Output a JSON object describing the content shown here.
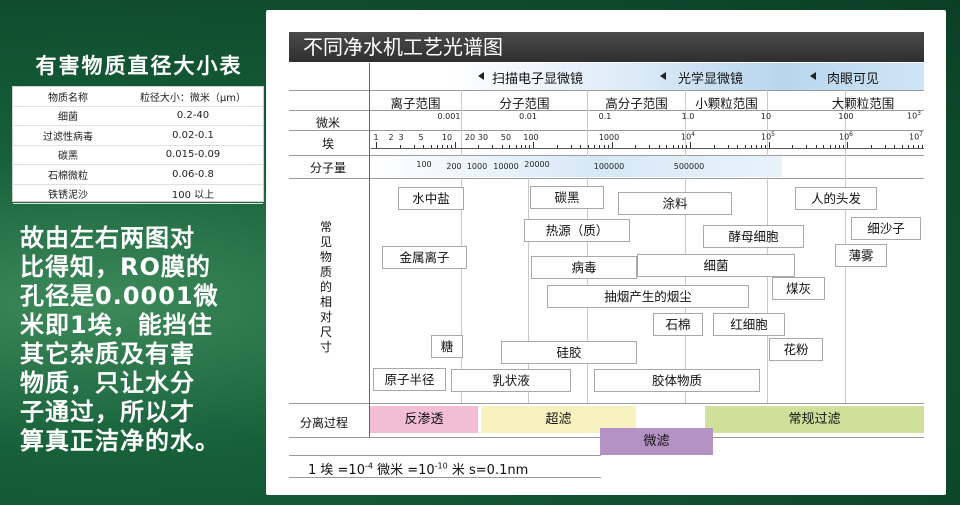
{
  "left": {
    "title": "有害物质直径大小表",
    "table_header": [
      "物质名称",
      "粒径大小：微米（μm）"
    ],
    "table_rows": [
      [
        "细菌",
        "0.2-40"
      ],
      [
        "过滤性病毒",
        "0.02-0.1"
      ],
      [
        "碳黑",
        "0.015-0.09"
      ],
      [
        "石棉微粒",
        "0.06-0.8"
      ],
      [
        "铁锈泥沙",
        "100 以上"
      ]
    ],
    "explanation": "故由左右两图对\n比得知，RO膜的\n孔径是0.0001微\n米即1埃，能挡住\n其它杂质及有害\n物质，只让水分\n子通过，所以才\n算真正洁净的水。"
  },
  "chart": {
    "title": "不同净水机工艺光谱图",
    "scopes": [
      "扫描电子显微镜",
      "光学显微镜",
      "肉眼可见"
    ],
    "ranges": [
      "离子范围",
      "分子范围",
      "高分子范围",
      "小颗粒范围",
      "大颗粒范围"
    ],
    "row_labels": {
      "micron": "微米",
      "angstrom": "埃",
      "molecular_weight": "分子量",
      "common": "常\n见\n物\n质\n的\n相\n对\n尺\n寸",
      "separation": "分离过程"
    },
    "micron_ticks": [
      "0.001",
      "0.01",
      "0.1",
      "1.0",
      "10",
      "100"
    ],
    "micron_tick_3": "10",
    "micron_tick_3_exp": "3",
    "angstrom_ticks": [
      "1",
      "2",
      "3",
      "5",
      "10",
      "20",
      "30",
      "50",
      "100",
      "1000"
    ],
    "angstrom_pow_base": "10",
    "angstrom_pow_exps": [
      "4",
      "5",
      "6",
      "7"
    ],
    "mw_ticks": [
      "100",
      "200",
      "1000",
      "10000",
      "20000",
      "100000",
      "500000"
    ],
    "substances": {
      "salt": "水中盐",
      "metal_ion": "金属离子",
      "sugar": "糖",
      "atomic_radius": "原子半径",
      "carbon_black": "碳黑",
      "pyrogen": "热源（质）",
      "virus": "病毒",
      "paint": "涂料",
      "smoke": "抽烟产生的烟尘",
      "silica_gel": "硅胶",
      "emulsion": "乳状液",
      "colloid": "胶体物质",
      "yeast": "酵母细胞",
      "bacteria": "细菌",
      "asbestos": "石棉",
      "rbc": "红细胞",
      "coal_ash": "煤灰",
      "pollen": "花粉",
      "hair": "人的头发",
      "fine_sand": "细沙子",
      "mist": "薄雾"
    },
    "processes": {
      "ro": "反渗透",
      "uf": "超滤",
      "mf": "微滤",
      "conventional": "常规过滤"
    },
    "process_colors": {
      "ro": "#f4bdd6",
      "uf": "#f7f2bf",
      "mf": "#b592c4",
      "conventional": "#cfe09a"
    },
    "footnote_parts": [
      "1 埃 =10",
      "-4",
      " 微米 =10",
      "-10",
      " 米 s=0.1nm"
    ]
  }
}
